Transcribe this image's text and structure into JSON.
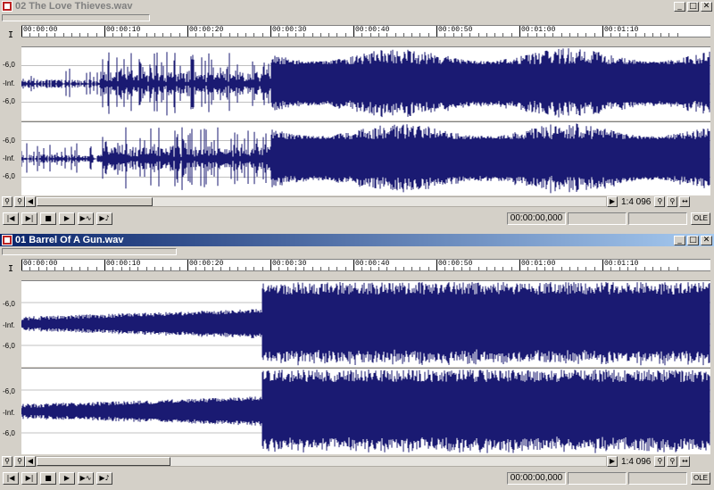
{
  "windows": [
    {
      "title": "02 The Love Thieves.wav",
      "active": false,
      "ruler_ticks": [
        "00:00:00",
        "00:00:10",
        "00:00:20",
        "00:00:30",
        "00:00:40",
        "00:00:50",
        "00:01:00",
        "00:01:10"
      ],
      "db_labels": [
        "-6,0",
        "-Inf.",
        "-6,0"
      ],
      "zoom": "1:4 096",
      "time": "00:00:00,000",
      "ole": "OLE"
    },
    {
      "title": "01 Barrel Of A Gun.wav",
      "active": true,
      "ruler_ticks": [
        "00:00:00",
        "00:00:10",
        "00:00:20",
        "00:00:30",
        "00:00:40",
        "00:00:50",
        "00:01:00",
        "00:01:10"
      ],
      "db_labels": [
        "-6,0",
        "-Inf.",
        "-6,0"
      ],
      "zoom": "1:4 096",
      "time": "00:00:00,000",
      "ole": "OLE"
    }
  ],
  "caption_buttons": {
    "minimize": "_",
    "maximize": "□",
    "close": "✕"
  },
  "icons": [
    "app-icon",
    "zoom-icon",
    "scroll-left-icon",
    "scroll-right-icon",
    "go-start-icon",
    "go-end-icon",
    "stop-icon",
    "play-icon",
    "play-all-icon",
    "play-loop-icon",
    "cursor-icon"
  ],
  "colors": {
    "waveform": "#1a1a72",
    "titlebar_active": "#0a246a",
    "background": "#d4d0c8"
  }
}
